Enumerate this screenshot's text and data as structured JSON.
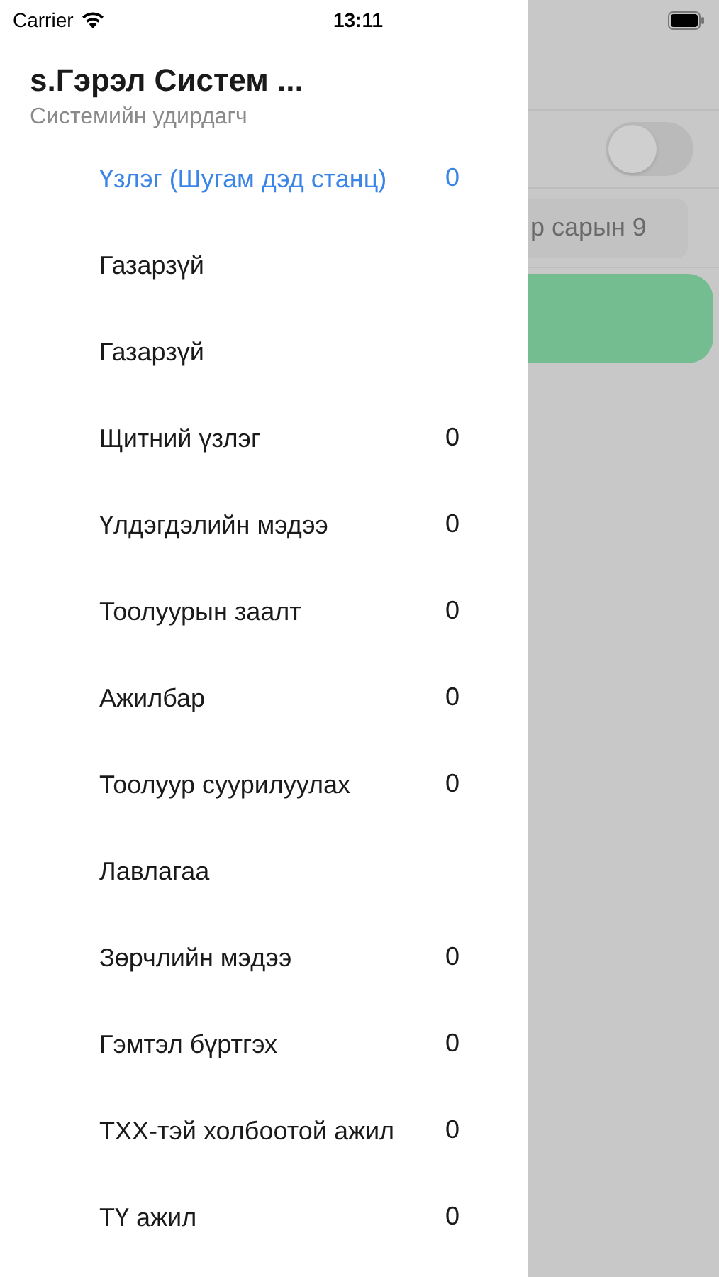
{
  "status_bar": {
    "carrier": "Carrier",
    "time": "13:11"
  },
  "drawer": {
    "title": "s.Гэрэл Систем ...",
    "subtitle": "Системийн удирдагч",
    "items": [
      {
        "label": "Үзлэг (Шугам дэд станц)",
        "count": "0",
        "selected": true
      },
      {
        "label": "Газарзүй",
        "selected": false
      },
      {
        "label": "Газарзүй",
        "selected": false
      },
      {
        "label": "Щитний үзлэг",
        "count": "0",
        "selected": false
      },
      {
        "label": "Үлдэгдэлийн мэдээ",
        "count": "0",
        "selected": false
      },
      {
        "label": "Тоолуурын заалт",
        "count": "0",
        "selected": false
      },
      {
        "label": "Ажилбар",
        "count": "0",
        "selected": false
      },
      {
        "label": "Тоолуур суурилуулах",
        "count": "0",
        "selected": false
      },
      {
        "label": "Лавлагаа",
        "selected": false
      },
      {
        "label": "Зөрчлийн мэдээ",
        "count": "0",
        "selected": false
      },
      {
        "label": "Гэмтэл бүртгэх",
        "count": "0",
        "selected": false
      },
      {
        "label": "ТХХ-тэй холбоотой ажил",
        "count": "0",
        "selected": false
      },
      {
        "label": "ТҮ ажил",
        "count": "0",
        "selected": false
      }
    ]
  },
  "background": {
    "toggle": {
      "on": false
    },
    "date_field": {
      "value": "р сарын 9"
    }
  }
}
